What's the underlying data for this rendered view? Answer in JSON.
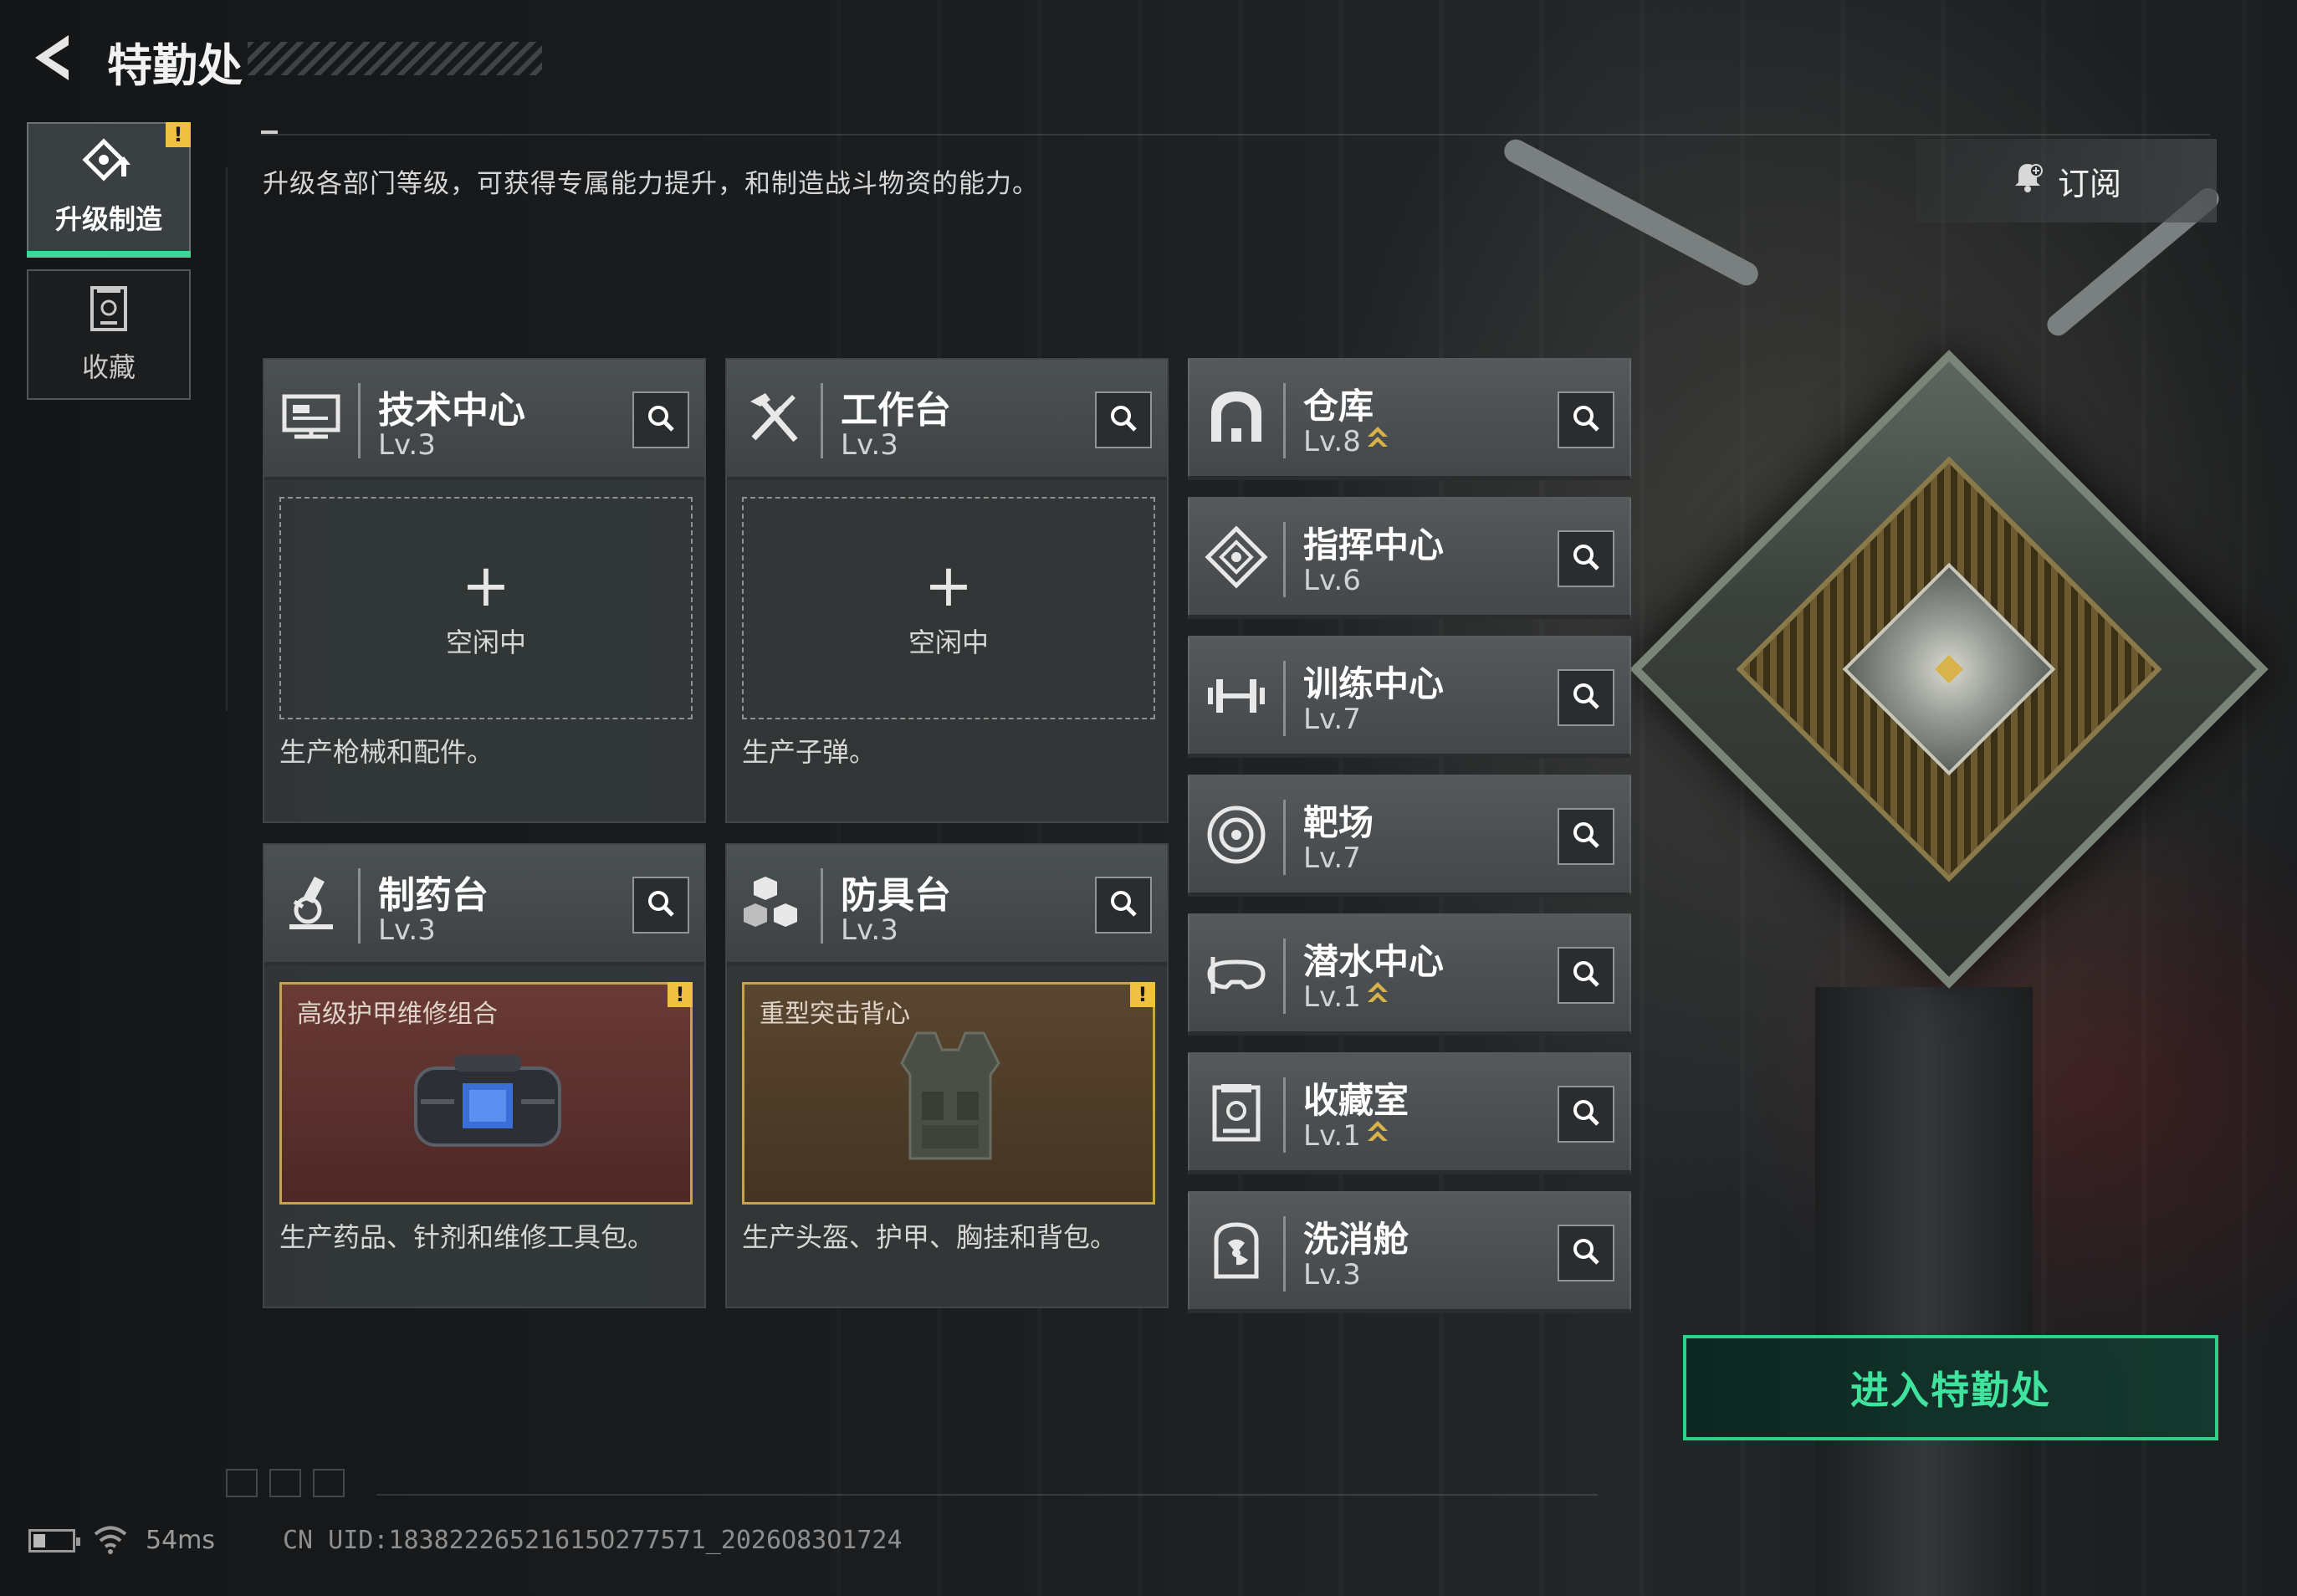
{
  "header": {
    "title": "特勤处",
    "description": "升级各部门等级，可获得专属能力提升，和制造战斗物资的能力。",
    "subscribe_label": "订阅"
  },
  "sidebar": {
    "items": [
      {
        "label": "升级制造",
        "icon": "upgrade-build-icon",
        "active": true,
        "alert": "!"
      },
      {
        "label": "收藏",
        "icon": "collection-icon",
        "active": false
      }
    ]
  },
  "production_facilities": [
    {
      "name": "技术中心",
      "level": "Lv.3",
      "icon": "monitor-icon",
      "slot_status": "空闲中",
      "slot_plus": "+",
      "description": "生产枪械和配件。"
    },
    {
      "name": "工作台",
      "level": "Lv.3",
      "icon": "tools-icon",
      "slot_status": "空闲中",
      "slot_plus": "+",
      "description": "生产子弹。"
    },
    {
      "name": "制药台",
      "level": "Lv.3",
      "icon": "microscope-icon",
      "product_name": "高级护甲维修组合",
      "product_alert": "!",
      "description": "生产药品、针剂和维修工具包。"
    },
    {
      "name": "防具台",
      "level": "Lv.3",
      "icon": "armor-blocks-icon",
      "product_name": "重型突击背心",
      "product_alert": "!",
      "description": "生产头盔、护甲、胸挂和背包。"
    }
  ],
  "other_facilities": [
    {
      "name": "仓库",
      "level": "Lv.8",
      "icon": "warehouse-icon",
      "upgradable": true
    },
    {
      "name": "指挥中心",
      "level": "Lv.6",
      "icon": "command-icon",
      "upgradable": false
    },
    {
      "name": "训练中心",
      "level": "Lv.7",
      "icon": "dumbbell-icon",
      "upgradable": false
    },
    {
      "name": "靶场",
      "level": "Lv.7",
      "icon": "target-icon",
      "upgradable": false
    },
    {
      "name": "潜水中心",
      "level": "Lv.1",
      "icon": "diving-mask-icon",
      "upgradable": true
    },
    {
      "name": "收藏室",
      "level": "Lv.1",
      "icon": "collection-room-icon",
      "upgradable": true
    },
    {
      "name": "洗消舱",
      "level": "Lv.3",
      "icon": "radiation-icon",
      "upgradable": false
    }
  ],
  "enter_button_label": "进入特勤处",
  "footer": {
    "ping": "54ms",
    "uid": "CN UID:18382226521615O277571_2026O83O1724"
  },
  "colors": {
    "accent_green": "#3dd598",
    "alert_yellow": "#f0c040",
    "upgrade_gold": "#d8b24a"
  }
}
